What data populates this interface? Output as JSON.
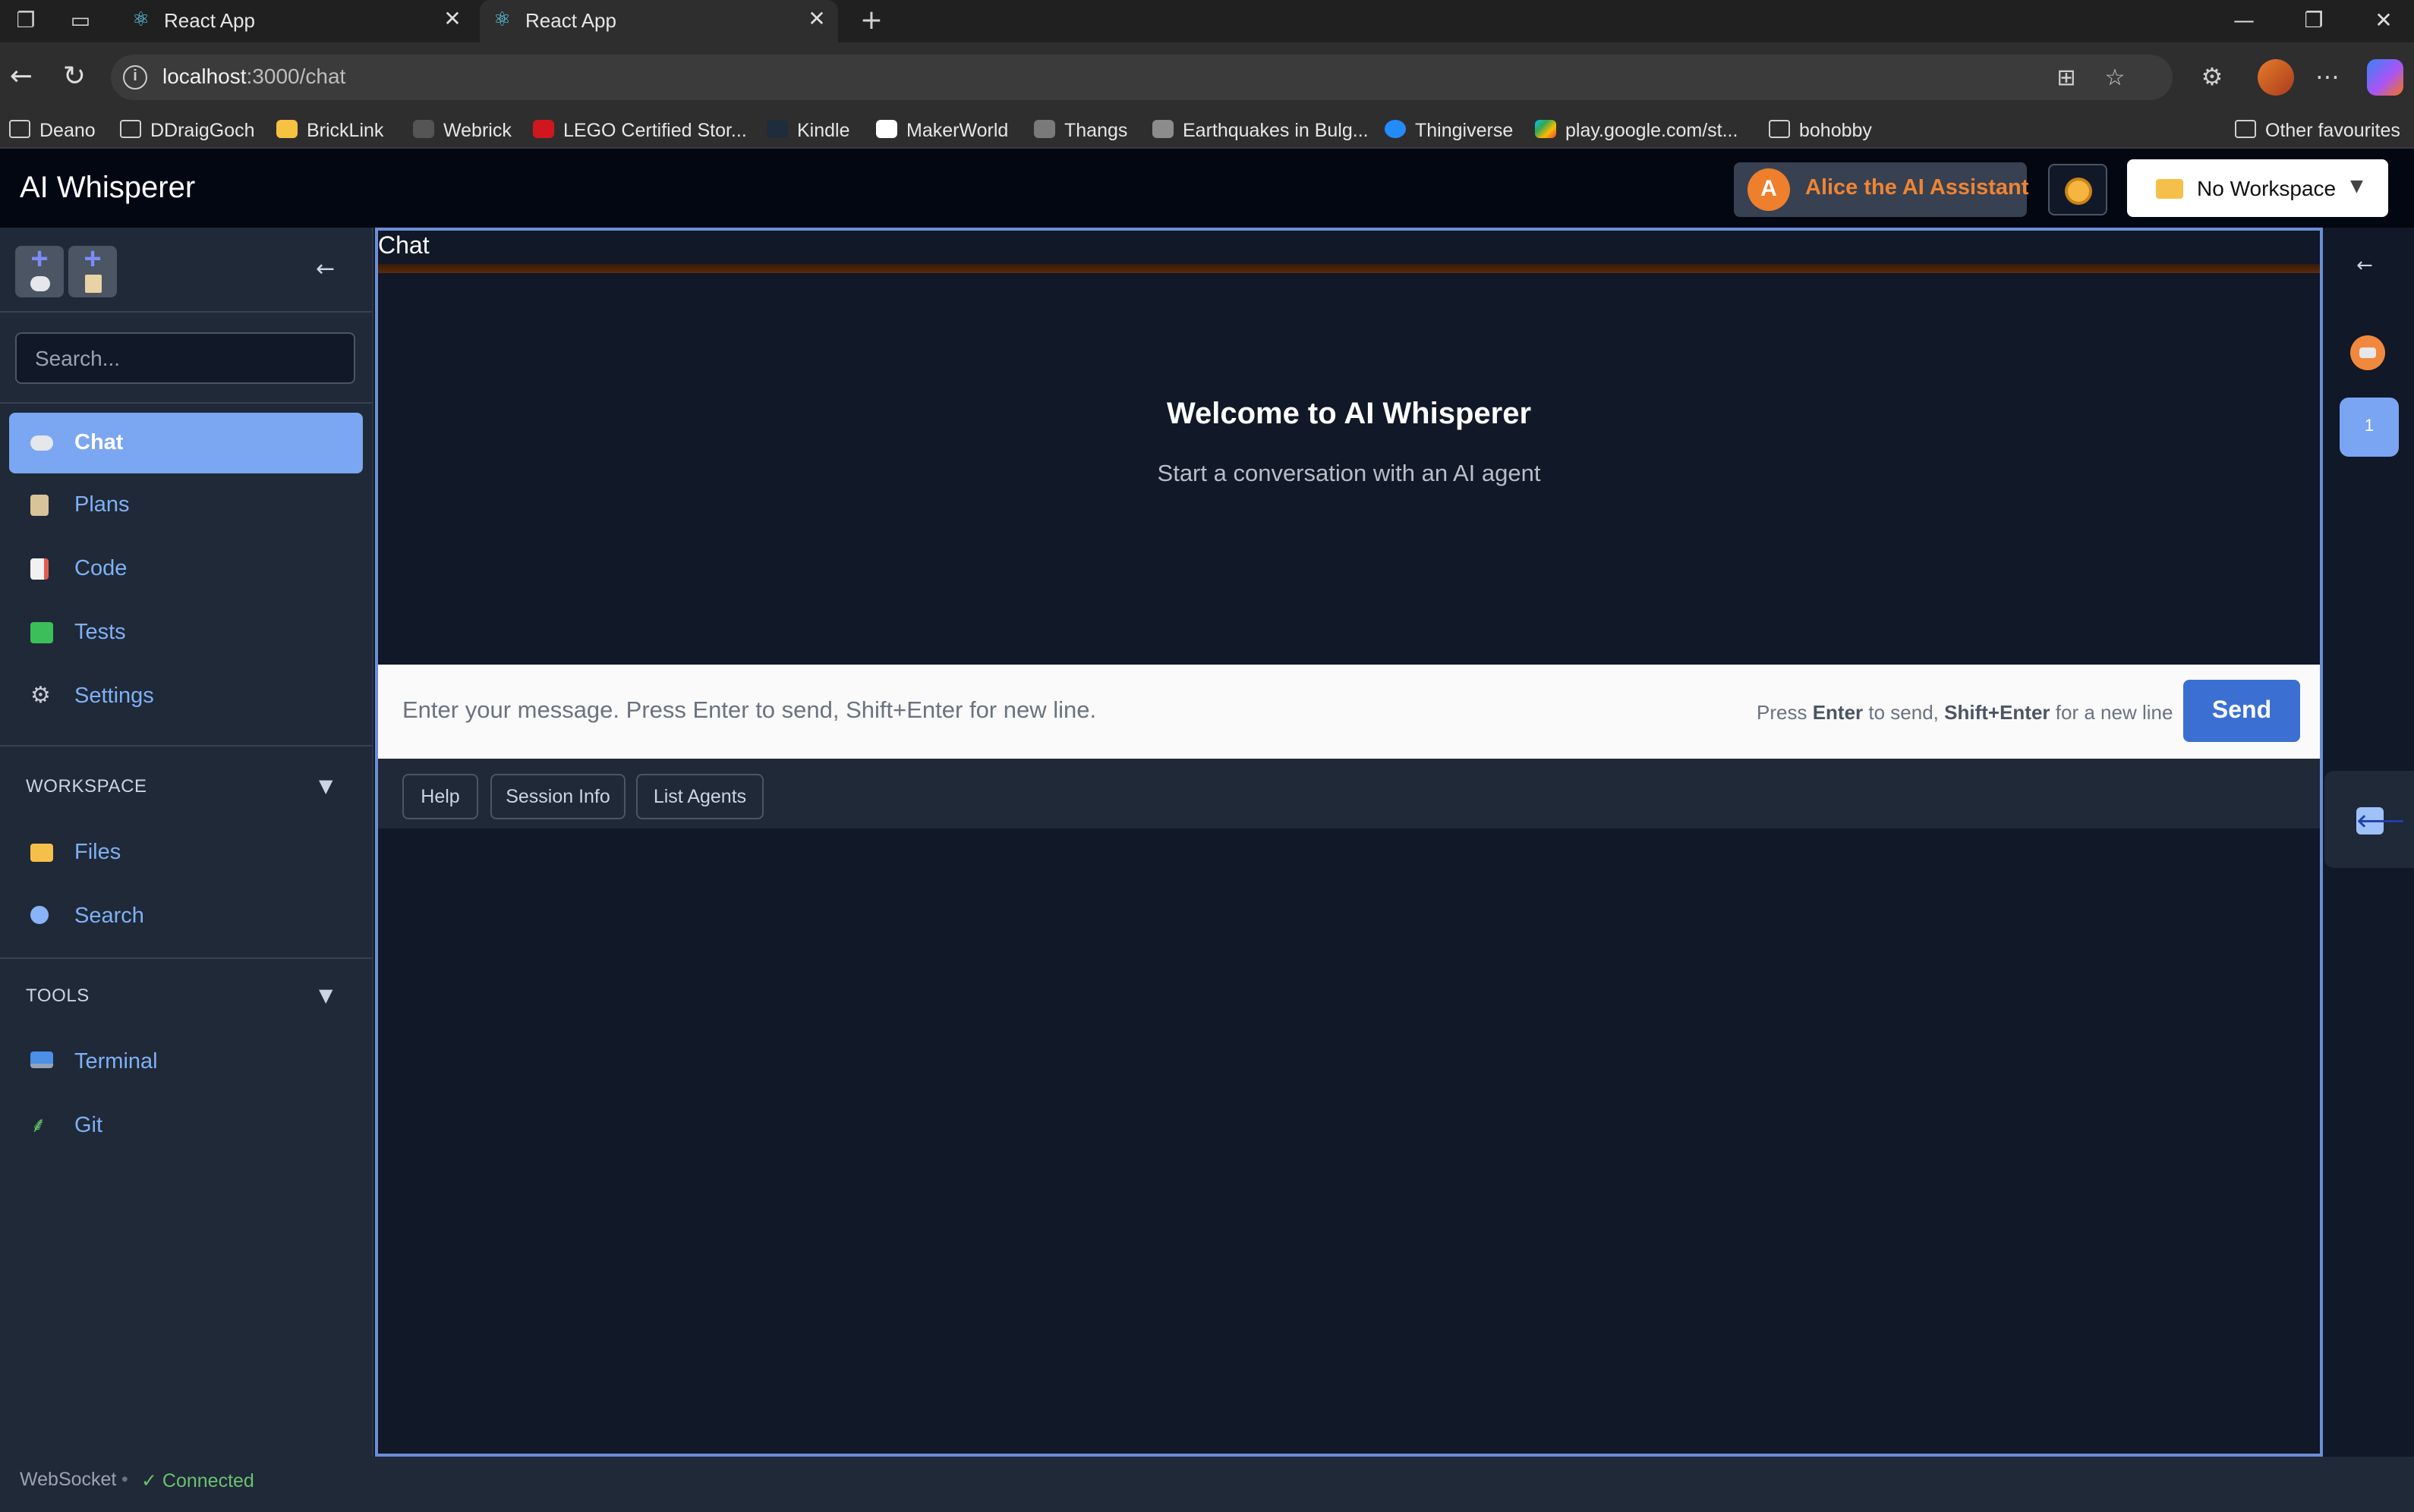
{
  "browser": {
    "tabs": [
      {
        "title": "React App",
        "active": false
      },
      {
        "title": "React App",
        "active": true
      }
    ],
    "url_host": "localhost",
    "url_path": ":3000/chat",
    "bookmarks": [
      "Deano",
      "DDraigGoch",
      "BrickLink",
      "Webrick",
      "LEGO Certified Stor...",
      "Kindle",
      "MakerWorld",
      "Thangs",
      "Earthquakes in Bulg...",
      "Thingiverse",
      "play.google.com/st...",
      "bohobby"
    ],
    "other_favourites": "Other favourites"
  },
  "header": {
    "title": "AI Whisperer",
    "agent_initial": "A",
    "agent_name": "Alice the AI Assistant",
    "workspace_label": "No Workspace",
    "workspace_caret": "▼"
  },
  "sidebar": {
    "search_placeholder": "Search...",
    "collapse_icon": "←",
    "nav": [
      {
        "label": "Chat",
        "icon": "chat-bubble-icon",
        "active": true
      },
      {
        "label": "Plans",
        "icon": "clipboard-icon",
        "active": false
      },
      {
        "label": "Code",
        "icon": "document-icon",
        "active": false
      },
      {
        "label": "Tests",
        "icon": "checkbox-icon",
        "active": false
      },
      {
        "label": "Settings",
        "icon": "gear-icon",
        "active": false
      }
    ],
    "workspace_section": {
      "title": "WORKSPACE",
      "caret": "▼",
      "items": [
        {
          "label": "Files",
          "icon": "folder-icon"
        },
        {
          "label": "Search",
          "icon": "magnifier-icon"
        }
      ]
    },
    "tools_section": {
      "title": "TOOLS",
      "caret": "▼",
      "items": [
        {
          "label": "Terminal",
          "icon": "monitor-icon"
        },
        {
          "label": "Git",
          "icon": "branch-icon"
        }
      ]
    }
  },
  "main": {
    "panel_title": "Chat",
    "welcome_title": "Welcome to AI Whisperer",
    "welcome_subtitle": "Start a conversation with an AI agent",
    "input_placeholder": "Enter your message. Press Enter to send, Shift+Enter for new line.",
    "hint_press": "Press ",
    "hint_enter": "Enter",
    "hint_to_send": " to send, ",
    "hint_shift_enter": "Shift+Enter",
    "hint_new_line": " for a new line",
    "send_label": "Send",
    "quick_actions": [
      "Help",
      "Session Info",
      "List Agents"
    ]
  },
  "right_rail": {
    "collapse_icon": "←",
    "badge_count": "1",
    "panel_icon": "🡐"
  },
  "status": {
    "label": "WebSocket",
    "separator": "•",
    "connection": "✓ Connected"
  },
  "colors": {
    "accent": "#3b70d2",
    "active_nav": "#7ba6f2",
    "agent_orange": "#ed7f2d",
    "connected_green": "#6cc070"
  }
}
